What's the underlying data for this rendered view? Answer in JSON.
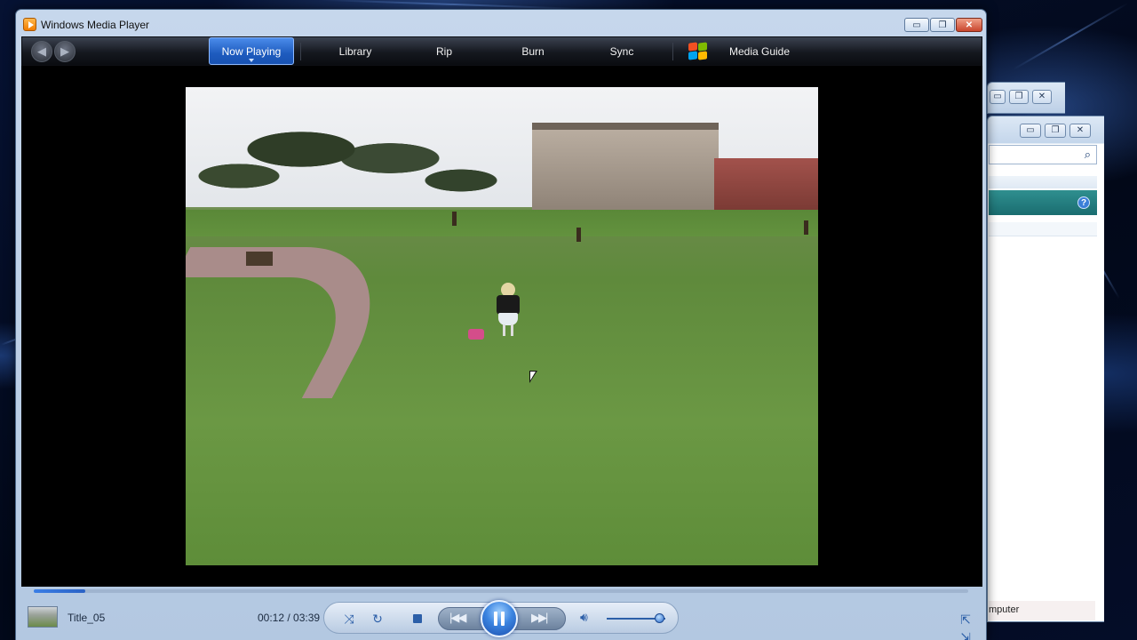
{
  "window": {
    "title": "Windows Media Player",
    "min_glyph": "▭",
    "max_glyph": "❐",
    "close_glyph": "✕"
  },
  "nav": {
    "back_icon": "back-arrow-icon",
    "forward_icon": "forward-arrow-icon",
    "tabs": [
      {
        "label": "Now Playing",
        "active": true
      },
      {
        "label": "Library"
      },
      {
        "label": "Rip"
      },
      {
        "label": "Burn"
      },
      {
        "label": "Sync"
      },
      {
        "label": "Media Guide"
      }
    ]
  },
  "player": {
    "track_title": "Title_05",
    "time": "00:12 / 03:39",
    "progress": 0.055,
    "volume": 0.9,
    "state": "playing"
  },
  "background_window": {
    "footer_text": "mputer"
  },
  "colors": {
    "accent": "#2c5fa8",
    "active_tab": "#1e5bbe"
  }
}
